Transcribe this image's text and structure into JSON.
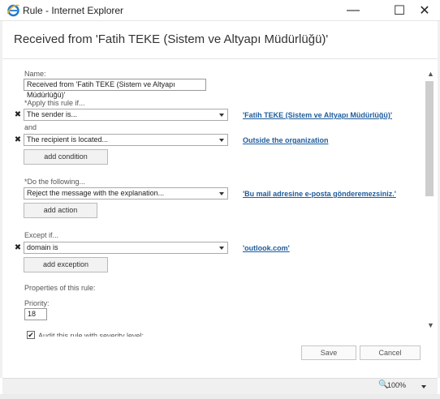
{
  "window": {
    "title": "Rule - Internet Explorer",
    "minimize_glyph": "—",
    "maximize_glyph": "☐",
    "close_glyph": "✕"
  },
  "page": {
    "title": "Received from 'Fatih TEKE (Sistem ve Altyapı Müdürlüğü)'"
  },
  "form": {
    "name_label": "Name:",
    "name_value": "Received from 'Fatih TEKE (Sistem ve Altyapı Müdürlüğü)'",
    "apply_label": "*Apply this rule if...",
    "conditions": [
      {
        "remove": "✖",
        "select": "The sender is...",
        "link": "'Fatih TEKE (Sistem ve Altyapı Müdürlüğü)'"
      },
      {
        "remove": "✖",
        "select": "The recipient is located...",
        "link": "Outside the organization"
      }
    ],
    "and_label": "and",
    "add_condition": "add condition",
    "do_label": "*Do the following...",
    "action": {
      "select": "Reject the message with the explanation...",
      "link": "'Bu mail adresine e-posta gönderemezsiniz.'"
    },
    "add_action": "add action",
    "except_label": "Except if...",
    "exception": {
      "remove": "✖",
      "select": "domain is",
      "link": "'outlook.com'"
    },
    "add_exception": "add exception",
    "properties_label": "Properties of this rule:",
    "priority_label": "Priority:",
    "priority_value": "18",
    "audit_label": "Audit this rule with severity level:",
    "audit_checked": "✔"
  },
  "footer": {
    "save": "Save",
    "cancel": "Cancel"
  },
  "status": {
    "zoom": "100%",
    "zoom_icon": "🔍"
  },
  "scroll": {
    "up": "▲",
    "down": "▼"
  },
  "colors": {
    "link": "#1e5c9b",
    "ie_blue": "#1f7ad1",
    "ie_gold": "#e9b32c"
  }
}
